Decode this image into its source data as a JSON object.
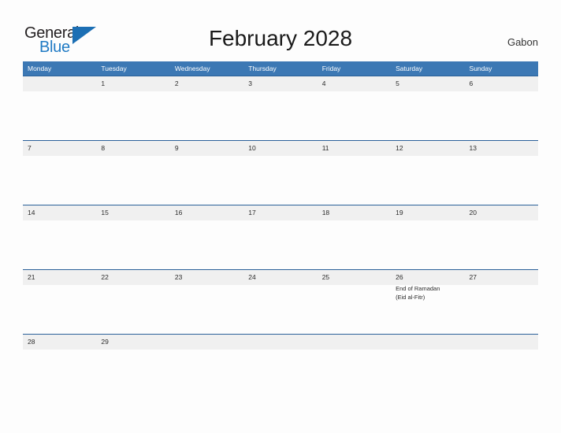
{
  "brand": {
    "name_part1": "General",
    "name_part2": "Blue",
    "logo_icon": "triangle-icon",
    "color_dark": "#231f20",
    "color_blue": "#1f7ac4"
  },
  "header": {
    "title": "February 2028",
    "country": "Gabon",
    "accent_color": "#3c78b4"
  },
  "calendar": {
    "weekdays": [
      "Monday",
      "Tuesday",
      "Wednesday",
      "Thursday",
      "Friday",
      "Saturday",
      "Sunday"
    ],
    "weeks": [
      {
        "days": [
          {
            "number": "",
            "events": []
          },
          {
            "number": "1",
            "events": []
          },
          {
            "number": "2",
            "events": []
          },
          {
            "number": "3",
            "events": []
          },
          {
            "number": "4",
            "events": []
          },
          {
            "number": "5",
            "events": []
          },
          {
            "number": "6",
            "events": []
          }
        ]
      },
      {
        "days": [
          {
            "number": "7",
            "events": []
          },
          {
            "number": "8",
            "events": []
          },
          {
            "number": "9",
            "events": []
          },
          {
            "number": "10",
            "events": []
          },
          {
            "number": "11",
            "events": []
          },
          {
            "number": "12",
            "events": []
          },
          {
            "number": "13",
            "events": []
          }
        ]
      },
      {
        "days": [
          {
            "number": "14",
            "events": []
          },
          {
            "number": "15",
            "events": []
          },
          {
            "number": "16",
            "events": []
          },
          {
            "number": "17",
            "events": []
          },
          {
            "number": "18",
            "events": []
          },
          {
            "number": "19",
            "events": []
          },
          {
            "number": "20",
            "events": []
          }
        ]
      },
      {
        "days": [
          {
            "number": "21",
            "events": []
          },
          {
            "number": "22",
            "events": []
          },
          {
            "number": "23",
            "events": []
          },
          {
            "number": "24",
            "events": []
          },
          {
            "number": "25",
            "events": []
          },
          {
            "number": "26",
            "events": [
              "End of Ramadan",
              "(Eid al-Fitr)"
            ]
          },
          {
            "number": "27",
            "events": []
          }
        ]
      },
      {
        "days": [
          {
            "number": "28",
            "events": []
          },
          {
            "number": "29",
            "events": []
          },
          {
            "number": "",
            "events": []
          },
          {
            "number": "",
            "events": []
          },
          {
            "number": "",
            "events": []
          },
          {
            "number": "",
            "events": []
          },
          {
            "number": "",
            "events": []
          }
        ]
      }
    ]
  }
}
